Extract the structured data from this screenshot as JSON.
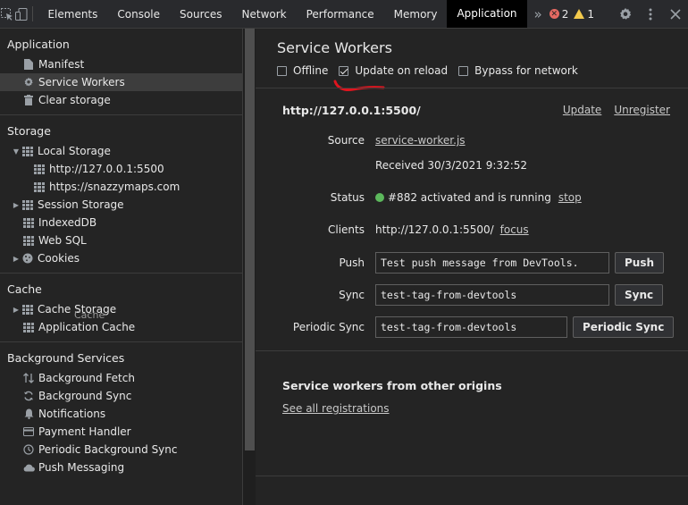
{
  "toolbar": {
    "tabs": [
      "Elements",
      "Console",
      "Sources",
      "Network",
      "Performance",
      "Memory",
      "Application"
    ],
    "more": "»",
    "errors": "2",
    "warnings": "1",
    "icons": [
      "inspect-icon",
      "device-toggle-icon",
      "gear-icon",
      "kebab-menu-icon",
      "close-icon"
    ]
  },
  "sidebar": {
    "application": {
      "title": "Application",
      "items": [
        "Manifest",
        "Service Workers",
        "Clear storage"
      ]
    },
    "storage": {
      "title": "Storage",
      "local_storage": "Local Storage",
      "local_children": [
        "http://127.0.0.1:5500",
        "https://snazzymaps.com"
      ],
      "items": [
        "Session Storage",
        "IndexedDB",
        "Web SQL",
        "Cookies"
      ]
    },
    "cache": {
      "title": "Cache",
      "items": [
        "Cache Storage",
        "Application Cache"
      ],
      "drag_ghost": "Cache"
    },
    "background": {
      "title": "Background Services",
      "items": [
        "Background Fetch",
        "Background Sync",
        "Notifications",
        "Payment Handler",
        "Periodic Background Sync",
        "Push Messaging"
      ]
    }
  },
  "main": {
    "title": "Service Workers",
    "options": {
      "offline": "Offline",
      "update_on_reload": "Update on reload",
      "bypass": "Bypass for network"
    },
    "scope": "http://127.0.0.1:5500/",
    "update": "Update",
    "unregister": "Unregister",
    "source_label": "Source",
    "source_file": "service-worker.js",
    "received": "Received 30/3/2021 9:32:52",
    "status_label": "Status",
    "status_text": "#882 activated and is running",
    "stop": "stop",
    "clients_label": "Clients",
    "client_url": "http://127.0.0.1:5500/",
    "focus": "focus",
    "push_label": "Push",
    "push_value": "Test push message from DevTools.",
    "push_button": "Push",
    "sync_label": "Sync",
    "sync_value": "test-tag-from-devtools",
    "sync_button": "Sync",
    "periodic_label": "Periodic Sync",
    "periodic_value": "test-tag-from-devtools",
    "periodic_button": "Periodic Sync",
    "other_origins_title": "Service workers from other origins",
    "see_all": "See all registrations"
  },
  "colors": {
    "background": "#242424",
    "status_green": "#5cb85c",
    "error_red": "#e46962",
    "warning_yellow": "#f2c94c",
    "annotation_red": "#e0141e"
  }
}
